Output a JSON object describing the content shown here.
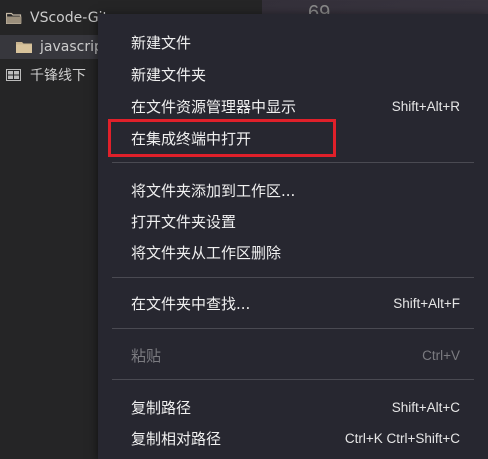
{
  "sidebar": {
    "items": [
      {
        "label": "VScode-Git",
        "icon": "folder-open-icon"
      },
      {
        "label": "javascript",
        "icon": "folder-icon"
      },
      {
        "label": "千锋线下",
        "icon": "workspace-icon"
      }
    ]
  },
  "background": {
    "number": "69"
  },
  "context_menu": {
    "items": [
      {
        "label": "新建文件",
        "shortcut": ""
      },
      {
        "label": "新建文件夹",
        "shortcut": ""
      },
      {
        "label": "在文件资源管理器中显示",
        "shortcut": "Shift+Alt+R"
      },
      {
        "label": "在集成终端中打开",
        "shortcut": ""
      },
      {
        "label": "将文件夹添加到工作区...",
        "shortcut": ""
      },
      {
        "label": "打开文件夹设置",
        "shortcut": ""
      },
      {
        "label": "将文件夹从工作区删除",
        "shortcut": ""
      },
      {
        "label": "在文件夹中查找...",
        "shortcut": "Shift+Alt+F"
      },
      {
        "label": "粘贴",
        "shortcut": "Ctrl+V",
        "disabled": true
      },
      {
        "label": "复制路径",
        "shortcut": "Shift+Alt+C"
      },
      {
        "label": "复制相对路径",
        "shortcut": "Ctrl+K Ctrl+Shift+C"
      }
    ]
  },
  "colors": {
    "highlight_border": "#e0202a",
    "menu_background": "#272730",
    "sidebar_background": "#252526"
  }
}
